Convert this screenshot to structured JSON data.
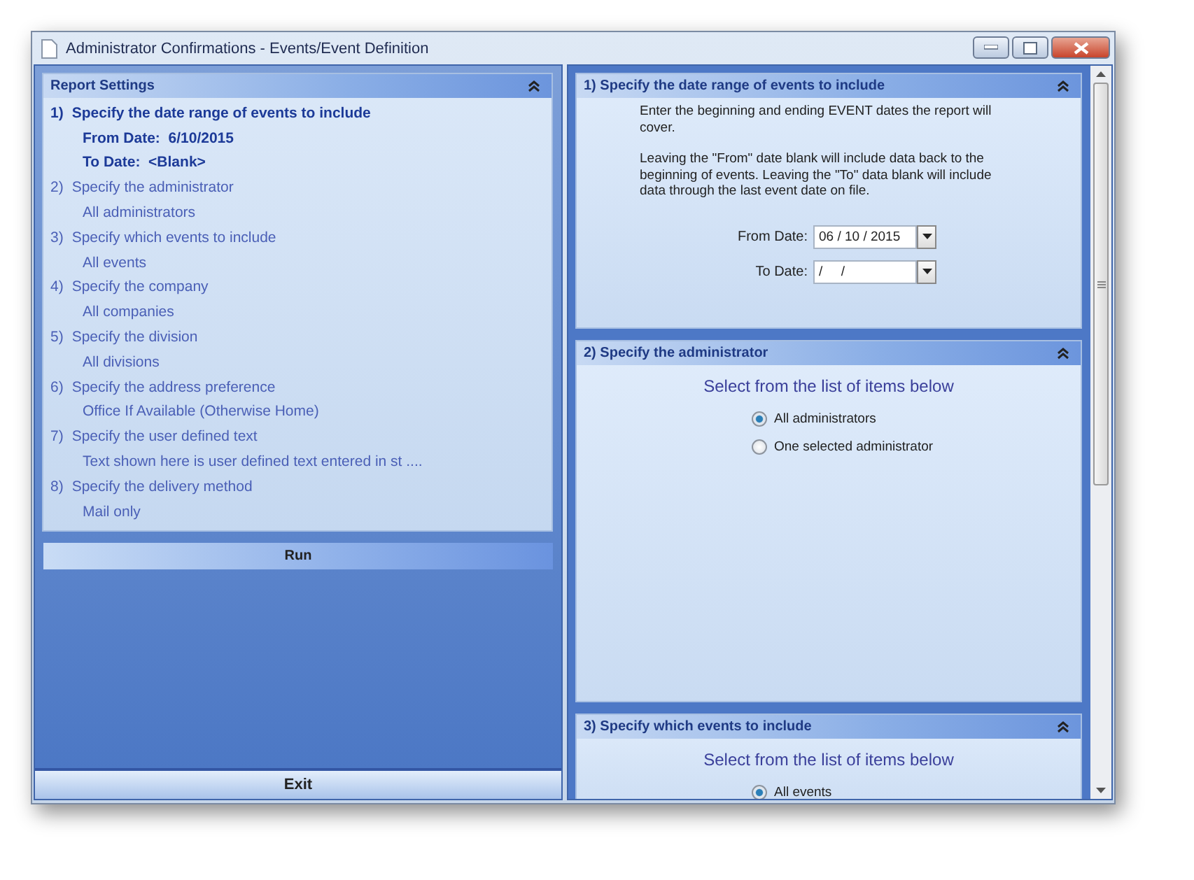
{
  "window": {
    "title": "Administrator Confirmations - Events/Event Definition"
  },
  "report_settings": {
    "title": "Report Settings",
    "steps": [
      {
        "number": "1)",
        "title": "Specify the date range of events to include",
        "active": true,
        "values": [
          "From Date:  6/10/2015",
          "To Date:  <Blank>"
        ]
      },
      {
        "number": "2)",
        "title": "Specify the administrator",
        "active": false,
        "values": [
          "All administrators"
        ]
      },
      {
        "number": "3)",
        "title": "Specify which events to include",
        "active": false,
        "values": [
          "All events"
        ]
      },
      {
        "number": "4)",
        "title": "Specify the company",
        "active": false,
        "values": [
          "All companies"
        ]
      },
      {
        "number": "5)",
        "title": "Specify the division",
        "active": false,
        "values": [
          "All divisions"
        ]
      },
      {
        "number": "6)",
        "title": "Specify the address preference",
        "active": false,
        "values": [
          "Office If Available (Otherwise Home)"
        ]
      },
      {
        "number": "7)",
        "title": "Specify the user defined text",
        "active": false,
        "values": [
          "Text shown here is user defined text entered in st ...."
        ]
      },
      {
        "number": "8)",
        "title": "Specify the delivery method",
        "active": false,
        "values": [
          "Mail only"
        ]
      }
    ]
  },
  "run_button": "Run",
  "exit_button": "Exit",
  "sections": [
    {
      "kind": "dates",
      "title": "1)  Specify the date range of events to include",
      "paragraphs": [
        "Enter the beginning and ending EVENT dates the report will cover.",
        "Leaving the \"From\" date blank will include data back to the beginning of events.  Leaving the \"To\" data blank will include data through the last event date on file."
      ],
      "fields": [
        {
          "label": "From Date:",
          "value": "06 / 10 / 2015"
        },
        {
          "label": "To Date:",
          "value": "/     /"
        }
      ]
    },
    {
      "kind": "radio",
      "title": "2)  Specify the administrator",
      "prompt": "Select from the list of items below",
      "options": [
        {
          "label": "All administrators",
          "selected": true
        },
        {
          "label": "One selected administrator",
          "selected": false
        }
      ]
    },
    {
      "kind": "radio",
      "title": "3)  Specify which events to include",
      "prompt": "Select from the list of items below",
      "options": [
        {
          "label": "All events",
          "selected": true
        }
      ]
    }
  ]
}
